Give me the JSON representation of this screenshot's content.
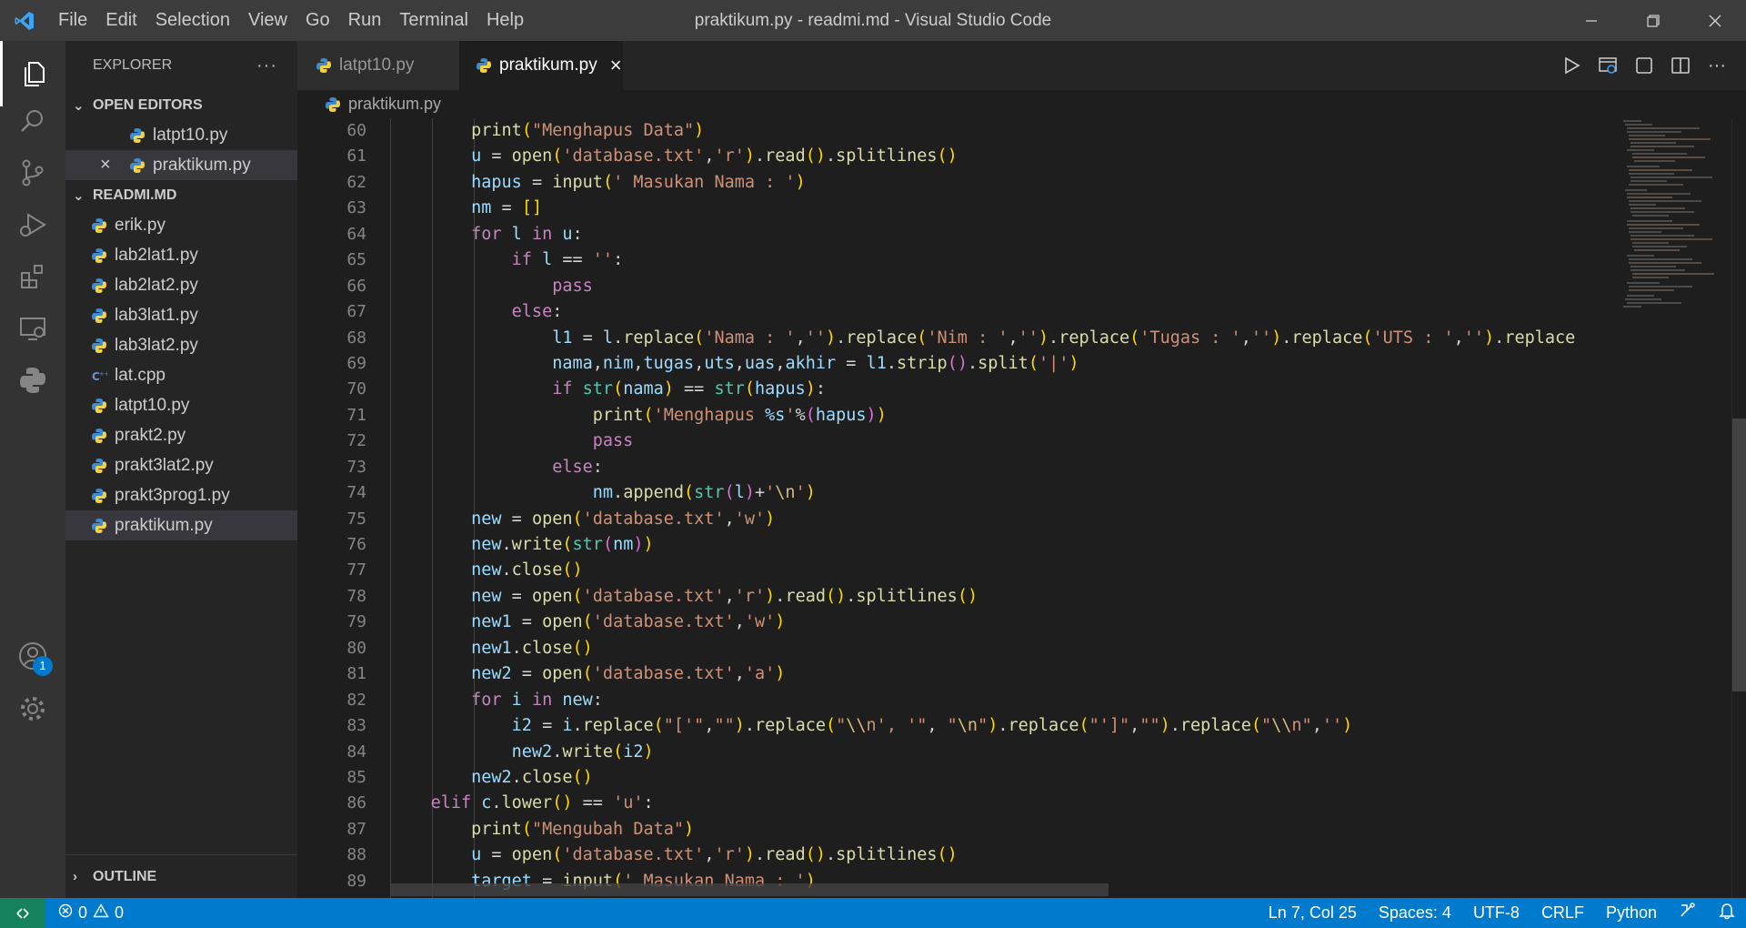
{
  "window": {
    "title": "praktikum.py - readmi.md - Visual Studio Code"
  },
  "menu": [
    "File",
    "Edit",
    "Selection",
    "View",
    "Go",
    "Run",
    "Terminal",
    "Help"
  ],
  "sidebar": {
    "header": "EXPLORER",
    "open_editors": {
      "label": "OPEN EDITORS",
      "items": [
        "latpt10.py",
        "praktikum.py"
      ]
    },
    "folder": {
      "label": "READMI.MD",
      "items": [
        "erik.py",
        "lab2lat1.py",
        "lab2lat2.py",
        "lab3lat1.py",
        "lab3lat2.py",
        "lat.cpp",
        "latpt10.py",
        "prakt2.py",
        "prakt3lat2.py",
        "prakt3prog1.py",
        "praktikum.py"
      ]
    },
    "outline": "OUTLINE"
  },
  "tabs": [
    {
      "label": "latpt10.py",
      "active": false
    },
    {
      "label": "praktikum.py",
      "active": true
    }
  ],
  "breadcrumb": "praktikum.py",
  "accounts_badge": "1",
  "editor": {
    "line_numbers": [
      "60",
      "61",
      "62",
      "63",
      "64",
      "65",
      "66",
      "67",
      "68",
      "69",
      "70",
      "71",
      "72",
      "73",
      "74",
      "75",
      "76",
      "77",
      "78",
      "79",
      "80",
      "81",
      "82",
      "83",
      "84",
      "85",
      "86",
      "87",
      "88",
      "89"
    ]
  },
  "statusbar": {
    "errors": "0",
    "warnings": "0",
    "position": "Ln 7, Col 25",
    "spaces": "Spaces: 4",
    "encoding": "UTF-8",
    "eol": "CRLF",
    "language": "Python"
  },
  "colors": {
    "accent": "#007acc",
    "activity_bar": "#333333",
    "sidebar": "#252526",
    "editor": "#1e1e1e",
    "titlebar": "#3c3c3c",
    "remote": "#16825d"
  }
}
